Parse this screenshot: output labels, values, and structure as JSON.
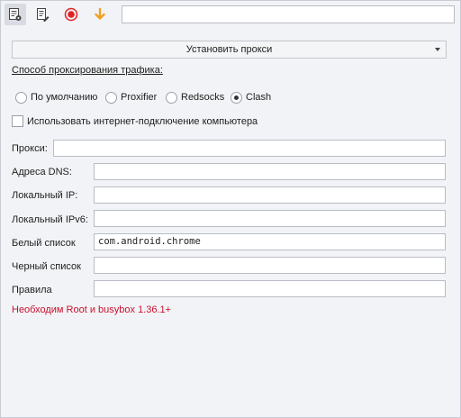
{
  "toolbar": {
    "icons": [
      "settings-doc-icon",
      "edit-doc-icon",
      "record-icon",
      "download-arrow-icon"
    ],
    "input_value": ""
  },
  "proxy": {
    "dropdown_label": "Установить прокси",
    "traffic_method_label": "Способ проксирования трафика:",
    "methods": [
      {
        "label": "По умолчанию",
        "checked": false
      },
      {
        "label": "Proxifier",
        "checked": false
      },
      {
        "label": "Redsocks",
        "checked": false
      },
      {
        "label": "Clash",
        "checked": true
      }
    ],
    "use_computer_internet_label": "Использовать интернет-подключение компьютера",
    "use_computer_internet_checked": false
  },
  "fields": {
    "proxy": {
      "label": "Прокси:",
      "value": ""
    },
    "dns": {
      "label": "Адреса DNS:",
      "value": ""
    },
    "local_ip": {
      "label": "Локальный IP:",
      "value": ""
    },
    "local_ipv6": {
      "label": "Локальный IPv6:",
      "value": ""
    },
    "whitelist": {
      "label": "Белый список",
      "value": "com.android.chrome"
    },
    "blacklist": {
      "label": "Черный список",
      "value": ""
    },
    "rules": {
      "label": "Правила",
      "value": ""
    }
  },
  "warning": "Необходим Root и busybox 1.36.1+",
  "colors": {
    "warning": "#c8102e",
    "record": "#e02424",
    "download": "#f0a020"
  }
}
